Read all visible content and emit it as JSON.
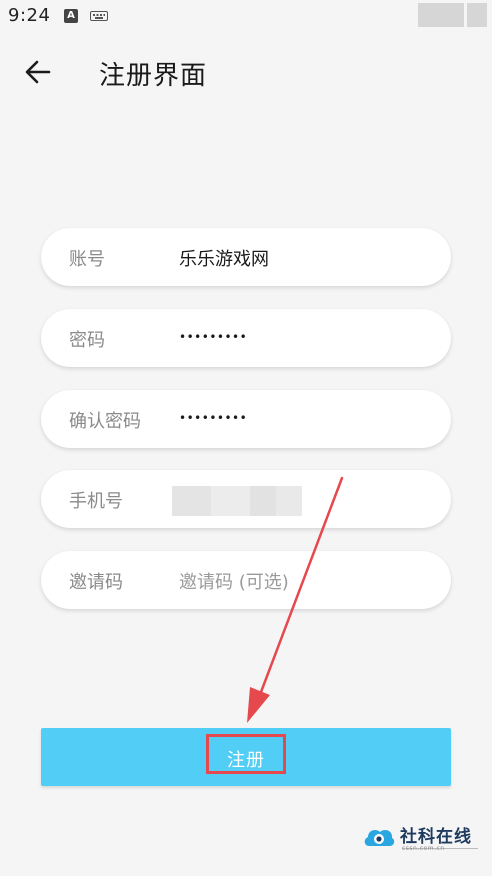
{
  "status_bar": {
    "time": "9:24",
    "a_badge": "A"
  },
  "header": {
    "title": "注册界面",
    "back_icon": "arrow-left-icon"
  },
  "form": {
    "account": {
      "label": "账号",
      "value": "乐乐游戏网"
    },
    "password": {
      "label": "密码",
      "value": "•••••••••"
    },
    "confirm_password": {
      "label": "确认密码",
      "value": "•••••••••"
    },
    "phone": {
      "label": "手机号"
    },
    "invite_code": {
      "label": "邀请码",
      "placeholder": "邀请码 (可选)"
    }
  },
  "register_button": {
    "label": "注册"
  },
  "watermark": {
    "text": "社科在线",
    "sub": "cssn.com.cn"
  },
  "colors": {
    "button": "#52cdf5",
    "annotation": "#e5484d",
    "background": "#f5f5f5"
  }
}
